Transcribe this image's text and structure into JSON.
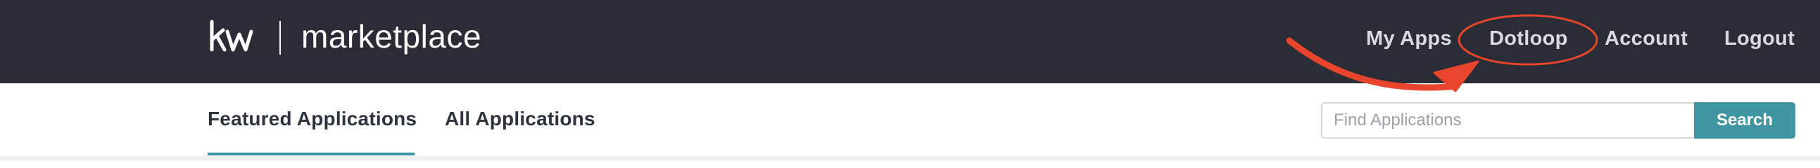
{
  "brand": {
    "logo_text": "kw",
    "product_name": "marketplace"
  },
  "nav": {
    "items": [
      {
        "label": "My Apps"
      },
      {
        "label": "Dotloop"
      },
      {
        "label": "Account"
      },
      {
        "label": "Logout"
      }
    ],
    "highlighted_item": "Dotloop"
  },
  "annotation": {
    "color": "#e8452c",
    "shapes": [
      "ellipse-around-dotloop",
      "curved-arrow-pointing-to-dotloop"
    ]
  },
  "tabs": {
    "items": [
      {
        "label": "Featured Applications",
        "active": true
      },
      {
        "label": "All Applications",
        "active": false
      }
    ]
  },
  "search": {
    "placeholder": "Find Applications",
    "value": "",
    "button_label": "Search"
  },
  "colors": {
    "topbar": "#2a2d35",
    "accent": "#3f95a2",
    "annotation": "#e8452c"
  }
}
